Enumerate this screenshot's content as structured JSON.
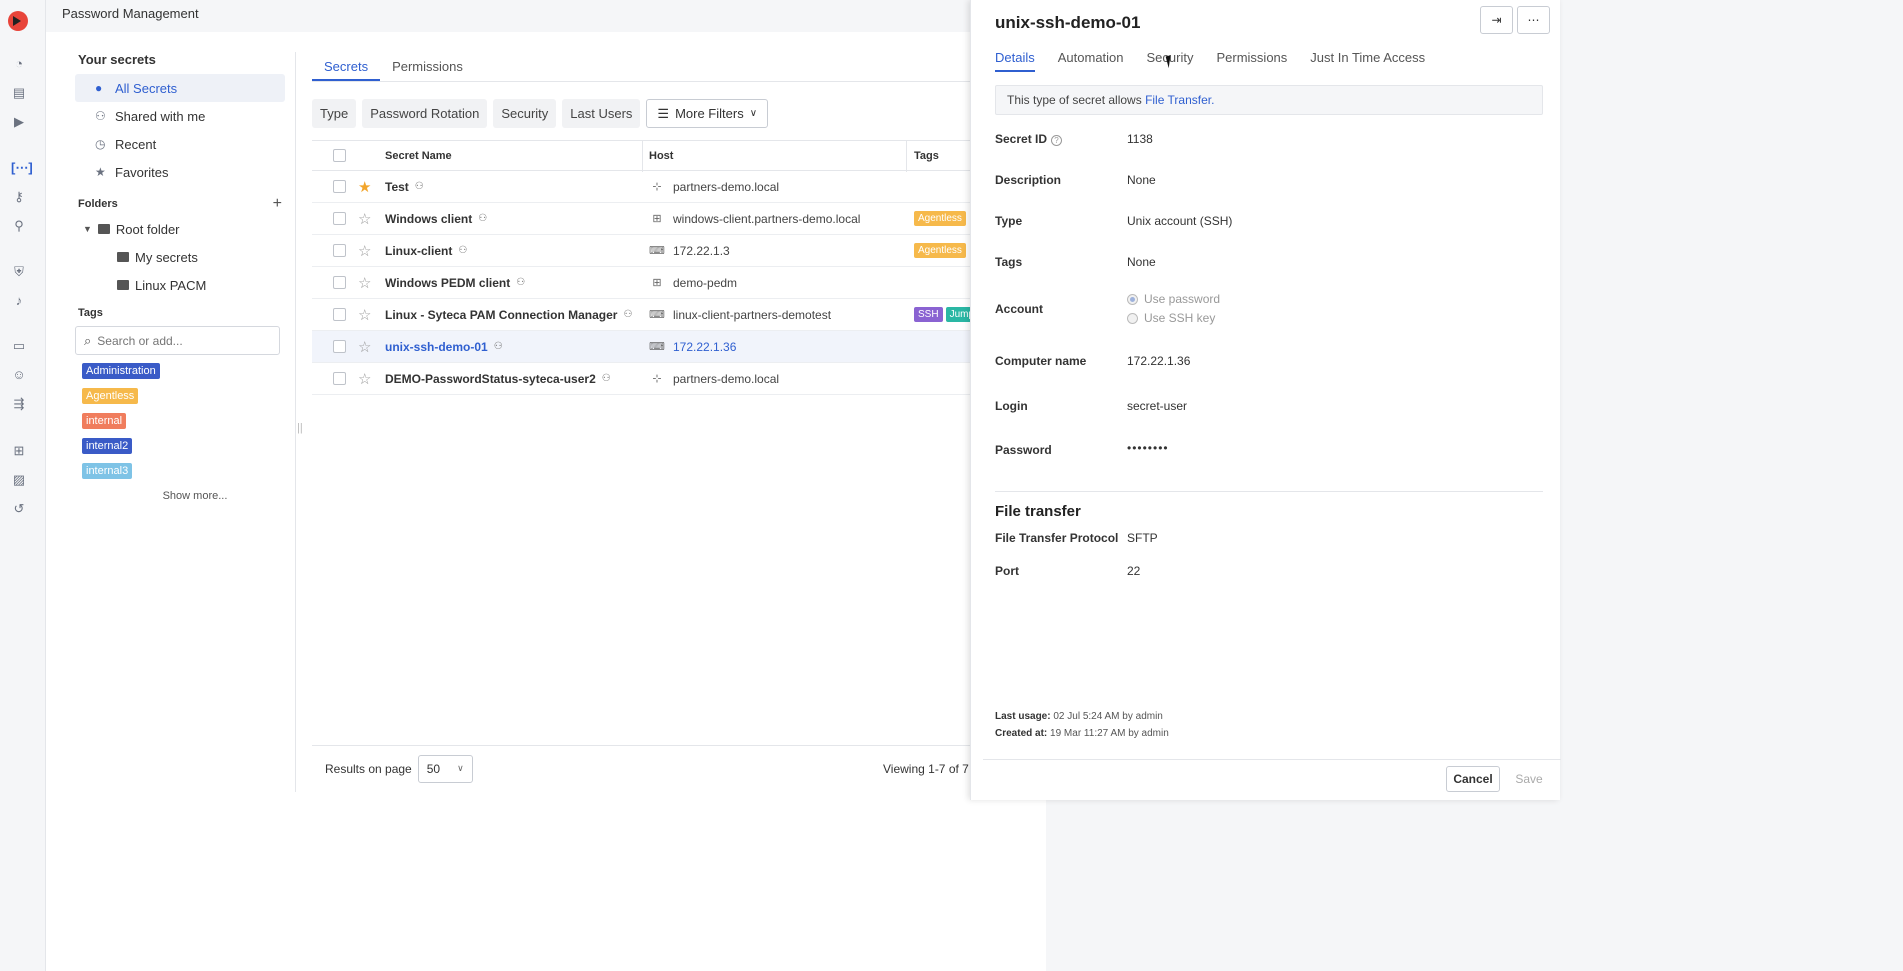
{
  "app": {
    "title": "Password Management"
  },
  "rail": {
    "icons": [
      "dashboard-icon",
      "document-icon",
      "play-icon",
      "secrets-icon",
      "key-icon",
      "user-key-icon",
      "shield-icon",
      "bell-icon",
      "monitor-icon",
      "person-icon",
      "usb-icon",
      "sitemap-icon",
      "chart-icon",
      "history-icon"
    ]
  },
  "sidebar": {
    "heading": "Your secrets",
    "items": [
      {
        "label": "All Secrets",
        "icon": "person-icon"
      },
      {
        "label": "Shared with me",
        "icon": "people-icon"
      },
      {
        "label": "Recent",
        "icon": "clock-icon"
      },
      {
        "label": "Favorites",
        "icon": "star-icon"
      }
    ],
    "folders_label": "Folders",
    "folders": [
      {
        "label": "Root folder"
      },
      {
        "label": "My secrets"
      },
      {
        "label": "Linux PACM"
      }
    ],
    "tags_label": "Tags",
    "tag_search_placeholder": "Search or add...",
    "tags": [
      {
        "label": "Administration",
        "color": "#3a5bc7"
      },
      {
        "label": "Agentless",
        "color": "#f6b94b"
      },
      {
        "label": "internal",
        "color": "#f07d5d"
      },
      {
        "label": "internal2",
        "color": "#3a5bc7"
      },
      {
        "label": "internal3",
        "color": "#7ec3e6"
      }
    ],
    "show_more": "Show more..."
  },
  "tabs": [
    {
      "label": "Secrets"
    },
    {
      "label": "Permissions"
    }
  ],
  "filters": [
    {
      "label": "Type"
    },
    {
      "label": "Password Rotation"
    },
    {
      "label": "Security"
    },
    {
      "label": "Last Users"
    }
  ],
  "more_filters": "More Filters",
  "table": {
    "columns": [
      "Secret Name",
      "Host",
      "Tags"
    ],
    "rows": [
      {
        "name": "Test",
        "host": "partners-demo.local",
        "host_icon": "network-icon",
        "favorite": true,
        "tags": []
      },
      {
        "name": "Windows client",
        "host": "windows-client.partners-demo.local",
        "host_icon": "windows-icon",
        "favorite": false,
        "tags": [
          {
            "label": "Agentless",
            "color": "#f6b94b"
          }
        ]
      },
      {
        "name": "Linux-client",
        "host": "172.22.1.3",
        "host_icon": "unix-icon",
        "favorite": false,
        "tags": [
          {
            "label": "Agentless",
            "color": "#f6b94b"
          }
        ]
      },
      {
        "name": "Windows PEDM client",
        "host": "demo-pedm",
        "host_icon": "windows-icon",
        "favorite": false,
        "tags": []
      },
      {
        "name": "Linux - Syteca PAM Connection Manager",
        "host": "linux-client-partners-demotest",
        "host_icon": "unix-icon",
        "favorite": false,
        "tags": [
          {
            "label": "SSH",
            "color": "#8a63d2"
          },
          {
            "label": "Jump",
            "color": "#2ab7a4"
          }
        ]
      },
      {
        "name": "unix-ssh-demo-01",
        "host": "172.22.1.36",
        "host_icon": "unix-icon",
        "favorite": false,
        "selected": true,
        "tags": []
      },
      {
        "name": "DEMO-PasswordStatus-syteca-user2",
        "host": "partners-demo.local",
        "host_icon": "network-icon",
        "favorite": false,
        "tags": []
      }
    ]
  },
  "footer": {
    "results_label": "Results on page",
    "results_value": "50",
    "viewing": "Viewing 1-7 of 7"
  },
  "drawer": {
    "title": "unix-ssh-demo-01",
    "tabs": [
      {
        "label": "Details"
      },
      {
        "label": "Automation"
      },
      {
        "label": "Security"
      },
      {
        "label": "Permissions"
      },
      {
        "label": "Just In Time Access"
      }
    ],
    "info_prefix": "This type of secret allows ",
    "info_link": "File Transfer.",
    "fields": {
      "secret_id_label": "Secret ID",
      "secret_id": "1138",
      "description_label": "Description",
      "description": "None",
      "type_label": "Type",
      "type": "Unix account (SSH)",
      "tags_label": "Tags",
      "tags": "None",
      "account_label": "Account",
      "account_opt1": "Use password",
      "account_opt2": "Use SSH key",
      "computer_label": "Computer name",
      "computer": "172.22.1.36",
      "login_label": "Login",
      "login": "secret-user",
      "password_label": "Password",
      "password": "••••••••"
    },
    "file_transfer": {
      "title": "File transfer",
      "protocol_label": "File Transfer Protocol",
      "protocol": "SFTP",
      "port_label": "Port",
      "port": "22"
    },
    "meta": {
      "last_usage_label": "Last usage:",
      "last_usage": "02 Jul 5:24 AM by admin",
      "created_label": "Created at:",
      "created": "19 Mar 11:27 AM by admin"
    },
    "cancel": "Cancel",
    "save": "Save"
  }
}
